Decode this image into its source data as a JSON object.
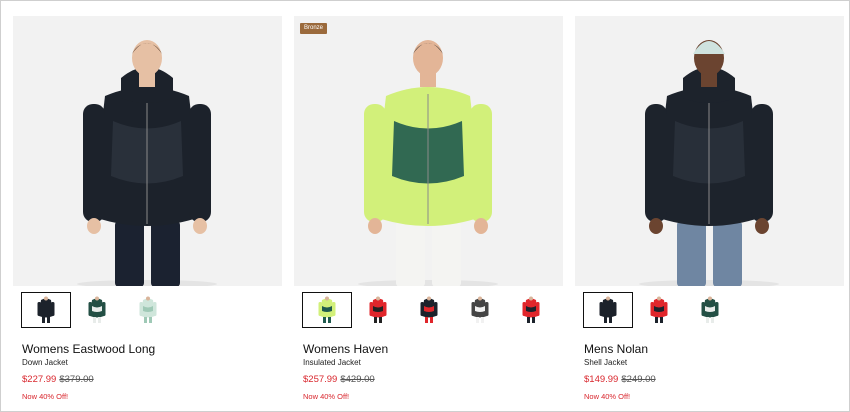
{
  "products": [
    {
      "name": "Womens Eastwood Long",
      "subtitle": "Down Jacket",
      "sale_price": "$227.99",
      "original_price": "$379.00",
      "promo": "Now 40% Off!",
      "badge": "",
      "colors": {
        "jacket": "#1c222b",
        "accent": "#2b323c",
        "pants": "#1b2230",
        "skin": "#e6c0a4",
        "hair": "#4a3426"
      },
      "swatches": [
        {
          "color": "#1c222b",
          "accent": "#1c222b",
          "selected": true
        },
        {
          "color": "#234f44",
          "accent": "#e8ecea",
          "selected": false
        },
        {
          "color": "#cfe6db",
          "accent": "#9fc9b6",
          "selected": false
        }
      ]
    },
    {
      "name": "Womens Haven",
      "subtitle": "Insulated Jacket",
      "sale_price": "$257.99",
      "original_price": "$429.00",
      "promo": "Now 40% Off!",
      "badge": "Bronze",
      "colors": {
        "jacket": "#d2f07a",
        "accent": "#1f5a4e",
        "pants": "#f4f4f2",
        "skin": "#e3b597",
        "hair": "#2a2a2a"
      },
      "swatches": [
        {
          "color": "#d2f07a",
          "accent": "#1f5a4e",
          "selected": true
        },
        {
          "color": "#e0262b",
          "accent": "#222222",
          "selected": false
        },
        {
          "color": "#1c222b",
          "accent": "#e0262b",
          "selected": false
        },
        {
          "color": "#444444",
          "accent": "#f1f1f1",
          "selected": false
        },
        {
          "color": "#e0262b",
          "accent": "#1c222b",
          "selected": false
        }
      ]
    },
    {
      "name": "Mens Nolan",
      "subtitle": "Shell Jacket",
      "sale_price": "$149.99",
      "original_price": "$249.00",
      "promo": "Now 40% Off!",
      "badge": "",
      "colors": {
        "jacket": "#1d232c",
        "accent": "#2a313b",
        "pants": "#6f86a2",
        "skin": "#6b4430",
        "hair": "#cfe3df"
      },
      "swatches": [
        {
          "color": "#1c222b",
          "accent": "#1c222b",
          "selected": true
        },
        {
          "color": "#e0262b",
          "accent": "#1c222b",
          "selected": false
        },
        {
          "color": "#234f44",
          "accent": "#e8ecea",
          "selected": false
        }
      ]
    }
  ]
}
